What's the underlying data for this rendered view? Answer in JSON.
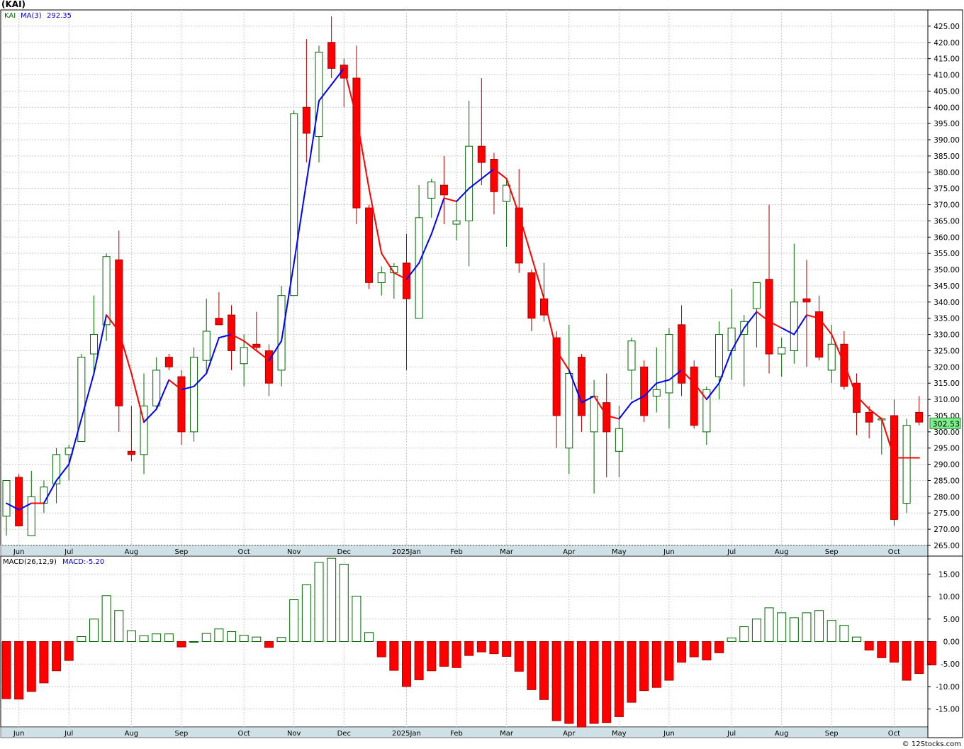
{
  "symbol_title": "(KAI)",
  "legend": {
    "ticker": "KAI",
    "ma_label": "MA(3)",
    "ma_value": "292.35",
    "macd_label": "MACD(26,12,9)",
    "macd_value_label": "MACD:-5.20"
  },
  "last_price_label": "302.53",
  "watermark": "© 12Stocks.com",
  "colors": {
    "up_candle": "#ffffff",
    "up_outline": "#006600",
    "down_candle": "#ff0000",
    "down_outline": "#aa0000",
    "wick": "#666666",
    "ma_up": "#0000ff",
    "ma_down": "#ff0000",
    "grid": "#c8c8c8",
    "axis_band": "#cfe0e6",
    "price_badge": "#7cf08a"
  },
  "chart_data": [
    {
      "type": "candlestick",
      "ylim": [
        265,
        430
      ],
      "yticks": [
        "265.00",
        "270.00",
        "275.00",
        "280.00",
        "285.00",
        "290.00",
        "295.00",
        "300.00",
        "305.00",
        "310.00",
        "315.00",
        "320.00",
        "325.00",
        "330.00",
        "335.00",
        "340.00",
        "345.00",
        "350.00",
        "355.00",
        "360.00",
        "365.00",
        "370.00",
        "375.00",
        "380.00",
        "385.00",
        "390.00",
        "395.00",
        "400.00",
        "405.00",
        "410.00",
        "415.00",
        "420.00",
        "425.00"
      ],
      "month_labels": [
        {
          "label": "Jun",
          "week": 1
        },
        {
          "label": "Jul",
          "week": 5
        },
        {
          "label": "Aug",
          "week": 10
        },
        {
          "label": "Sep",
          "week": 14
        },
        {
          "label": "Oct",
          "week": 19
        },
        {
          "label": "Nov",
          "week": 23
        },
        {
          "label": "Dec",
          "week": 27
        },
        {
          "label": "2025Jan",
          "week": 32
        },
        {
          "label": "Feb",
          "week": 36
        },
        {
          "label": "Mar",
          "week": 40
        },
        {
          "label": "Apr",
          "week": 45
        },
        {
          "label": "May",
          "week": 49
        },
        {
          "label": "Jun",
          "week": 53
        },
        {
          "label": "Jul",
          "week": 58
        },
        {
          "label": "Aug",
          "week": 62
        },
        {
          "label": "Sep",
          "week": 66
        },
        {
          "label": "Oct",
          "week": 71
        }
      ],
      "candles": [
        {
          "o": 274,
          "h": 285,
          "l": 268,
          "c": 285
        },
        {
          "o": 286,
          "h": 287,
          "l": 271,
          "c": 271
        },
        {
          "o": 268,
          "h": 288,
          "l": 268,
          "c": 280
        },
        {
          "o": 278,
          "h": 285,
          "l": 275,
          "c": 283
        },
        {
          "o": 284,
          "h": 295,
          "l": 278,
          "c": 293
        },
        {
          "o": 293,
          "h": 296,
          "l": 285,
          "c": 295
        },
        {
          "o": 297,
          "h": 324,
          "l": 297,
          "c": 323
        },
        {
          "o": 324,
          "h": 342,
          "l": 318,
          "c": 330
        },
        {
          "o": 333,
          "h": 355,
          "l": 328,
          "c": 354
        },
        {
          "o": 353,
          "h": 362,
          "l": 300,
          "c": 308
        },
        {
          "o": 294,
          "h": 308,
          "l": 291,
          "c": 293
        },
        {
          "o": 293,
          "h": 318,
          "l": 287,
          "c": 308
        },
        {
          "o": 308,
          "h": 323,
          "l": 307,
          "c": 319
        },
        {
          "o": 323,
          "h": 324,
          "l": 319,
          "c": 320
        },
        {
          "o": 317,
          "h": 319,
          "l": 296,
          "c": 300
        },
        {
          "o": 300,
          "h": 326,
          "l": 297,
          "c": 323
        },
        {
          "o": 322,
          "h": 341,
          "l": 318,
          "c": 331
        },
        {
          "o": 335,
          "h": 343,
          "l": 333,
          "c": 333
        },
        {
          "o": 336,
          "h": 339,
          "l": 319,
          "c": 325
        },
        {
          "o": 321,
          "h": 330,
          "l": 314,
          "c": 326
        },
        {
          "o": 327,
          "h": 337,
          "l": 325,
          "c": 326
        },
        {
          "o": 325,
          "h": 327,
          "l": 311,
          "c": 315
        },
        {
          "o": 319,
          "h": 345,
          "l": 314,
          "c": 342
        },
        {
          "o": 342,
          "h": 399,
          "l": 342,
          "c": 398
        },
        {
          "o": 400,
          "h": 421,
          "l": 383,
          "c": 392
        },
        {
          "o": 391,
          "h": 419,
          "l": 383,
          "c": 417
        },
        {
          "o": 420,
          "h": 428,
          "l": 409,
          "c": 412
        },
        {
          "o": 413,
          "h": 415,
          "l": 400,
          "c": 409
        },
        {
          "o": 409,
          "h": 419,
          "l": 364,
          "c": 369
        },
        {
          "o": 369,
          "h": 370,
          "l": 344,
          "c": 346
        },
        {
          "o": 346,
          "h": 351,
          "l": 342,
          "c": 349
        },
        {
          "o": 349,
          "h": 352,
          "l": 341,
          "c": 351
        },
        {
          "o": 352,
          "h": 361,
          "l": 319,
          "c": 341
        },
        {
          "o": 335,
          "h": 376,
          "l": 335,
          "c": 366
        },
        {
          "o": 372,
          "h": 378,
          "l": 366,
          "c": 377
        },
        {
          "o": 376,
          "h": 385,
          "l": 364,
          "c": 373
        },
        {
          "o": 364,
          "h": 371,
          "l": 359,
          "c": 365
        },
        {
          "o": 365,
          "h": 402,
          "l": 351,
          "c": 388
        },
        {
          "o": 388,
          "h": 409,
          "l": 376,
          "c": 383
        },
        {
          "o": 384,
          "h": 386,
          "l": 367,
          "c": 374
        },
        {
          "o": 371,
          "h": 378,
          "l": 357,
          "c": 376
        },
        {
          "o": 369,
          "h": 381,
          "l": 349,
          "c": 352
        },
        {
          "o": 349,
          "h": 350,
          "l": 331,
          "c": 335
        },
        {
          "o": 341,
          "h": 352,
          "l": 334,
          "c": 336
        },
        {
          "o": 329,
          "h": 331,
          "l": 295,
          "c": 305
        },
        {
          "o": 295,
          "h": 333,
          "l": 287,
          "c": 318
        },
        {
          "o": 323,
          "h": 324,
          "l": 300,
          "c": 305
        },
        {
          "o": 300,
          "h": 316,
          "l": 281,
          "c": 311
        },
        {
          "o": 309,
          "h": 318,
          "l": 286,
          "c": 300
        },
        {
          "o": 294,
          "h": 308,
          "l": 286,
          "c": 301
        },
        {
          "o": 319,
          "h": 329,
          "l": 310,
          "c": 328
        },
        {
          "o": 320,
          "h": 322,
          "l": 303,
          "c": 305
        },
        {
          "o": 311,
          "h": 326,
          "l": 306,
          "c": 313
        },
        {
          "o": 312,
          "h": 332,
          "l": 301,
          "c": 330
        },
        {
          "o": 333,
          "h": 339,
          "l": 311,
          "c": 315
        },
        {
          "o": 320,
          "h": 322,
          "l": 301,
          "c": 302
        },
        {
          "o": 300,
          "h": 314,
          "l": 296,
          "c": 313
        },
        {
          "o": 317,
          "h": 334,
          "l": 310,
          "c": 330
        },
        {
          "o": 325,
          "h": 344,
          "l": 316,
          "c": 332
        },
        {
          "o": 330,
          "h": 336,
          "l": 314,
          "c": 334
        },
        {
          "o": 338,
          "h": 346,
          "l": 326,
          "c": 346
        },
        {
          "o": 347,
          "h": 370,
          "l": 318,
          "c": 324
        },
        {
          "o": 324,
          "h": 329,
          "l": 317,
          "c": 326
        },
        {
          "o": 325,
          "h": 358,
          "l": 321,
          "c": 340
        },
        {
          "o": 341,
          "h": 353,
          "l": 320,
          "c": 340
        },
        {
          "o": 337,
          "h": 342,
          "l": 322,
          "c": 323
        },
        {
          "o": 319,
          "h": 333,
          "l": 315,
          "c": 327
        },
        {
          "o": 327,
          "h": 331,
          "l": 313,
          "c": 314
        },
        {
          "o": 315,
          "h": 318,
          "l": 299,
          "c": 306
        },
        {
          "o": 306,
          "h": 308,
          "l": 298,
          "c": 303
        },
        {
          "o": 304,
          "h": 304,
          "l": 293,
          "c": 304
        },
        {
          "o": 305,
          "h": 310,
          "l": 271,
          "c": 273
        },
        {
          "o": 278,
          "h": 304,
          "l": 275,
          "c": 302
        },
        {
          "o": 306,
          "h": 311,
          "l": 302,
          "c": 303
        }
      ],
      "ma": [
        {
          "v": 278,
          "dir": "down"
        },
        {
          "v": 276,
          "dir": "up"
        },
        {
          "v": 278,
          "dir": "up"
        },
        {
          "v": 278,
          "dir": "down"
        },
        {
          "v": 285,
          "dir": "up"
        },
        {
          "v": 290,
          "dir": "up"
        },
        {
          "v": 304,
          "dir": "up"
        },
        {
          "v": 318,
          "dir": "up"
        },
        {
          "v": 336,
          "dir": "up"
        },
        {
          "v": 331,
          "dir": "down"
        },
        {
          "v": 318,
          "dir": "down"
        },
        {
          "v": 303,
          "dir": "down"
        },
        {
          "v": 307,
          "dir": "up"
        },
        {
          "v": 316,
          "dir": "up"
        },
        {
          "v": 313,
          "dir": "down"
        },
        {
          "v": 314,
          "dir": "up"
        },
        {
          "v": 318,
          "dir": "up"
        },
        {
          "v": 329,
          "dir": "up"
        },
        {
          "v": 330,
          "dir": "up"
        },
        {
          "v": 328,
          "dir": "down"
        },
        {
          "v": 325,
          "dir": "down"
        },
        {
          "v": 322,
          "dir": "down"
        },
        {
          "v": 328,
          "dir": "up"
        },
        {
          "v": 352,
          "dir": "up"
        },
        {
          "v": 377,
          "dir": "up"
        },
        {
          "v": 402,
          "dir": "up"
        },
        {
          "v": 407,
          "dir": "up"
        },
        {
          "v": 412,
          "dir": "up"
        },
        {
          "v": 397,
          "dir": "down"
        },
        {
          "v": 375,
          "dir": "down"
        },
        {
          "v": 355,
          "dir": "down"
        },
        {
          "v": 349,
          "dir": "down"
        },
        {
          "v": 347,
          "dir": "down"
        },
        {
          "v": 352,
          "dir": "up"
        },
        {
          "v": 361,
          "dir": "up"
        },
        {
          "v": 372,
          "dir": "up"
        },
        {
          "v": 371,
          "dir": "down"
        },
        {
          "v": 375,
          "dir": "up"
        },
        {
          "v": 378,
          "dir": "up"
        },
        {
          "v": 381,
          "dir": "up"
        },
        {
          "v": 378,
          "dir": "down"
        },
        {
          "v": 367,
          "dir": "down"
        },
        {
          "v": 354,
          "dir": "down"
        },
        {
          "v": 341,
          "dir": "down"
        },
        {
          "v": 325,
          "dir": "down"
        },
        {
          "v": 319,
          "dir": "down"
        },
        {
          "v": 309,
          "dir": "up"
        },
        {
          "v": 311,
          "dir": "up"
        },
        {
          "v": 305,
          "dir": "down"
        },
        {
          "v": 304,
          "dir": "down"
        },
        {
          "v": 309,
          "dir": "up"
        },
        {
          "v": 311,
          "dir": "up"
        },
        {
          "v": 315,
          "dir": "up"
        },
        {
          "v": 316,
          "dir": "up"
        },
        {
          "v": 319,
          "dir": "up"
        },
        {
          "v": 315,
          "dir": "down"
        },
        {
          "v": 310,
          "dir": "down"
        },
        {
          "v": 315,
          "dir": "up"
        },
        {
          "v": 325,
          "dir": "up"
        },
        {
          "v": 332,
          "dir": "up"
        },
        {
          "v": 337,
          "dir": "up"
        },
        {
          "v": 334,
          "dir": "down"
        },
        {
          "v": 332,
          "dir": "down"
        },
        {
          "v": 330,
          "dir": "up"
        },
        {
          "v": 336,
          "dir": "up"
        },
        {
          "v": 335,
          "dir": "down"
        },
        {
          "v": 330,
          "dir": "down"
        },
        {
          "v": 321,
          "dir": "down"
        },
        {
          "v": 311,
          "dir": "down"
        },
        {
          "v": 307,
          "dir": "down"
        },
        {
          "v": 304,
          "dir": "down"
        },
        {
          "v": 292,
          "dir": "down"
        },
        {
          "v": 292,
          "dir": "down"
        },
        {
          "v": 292,
          "dir": "down"
        }
      ]
    },
    {
      "type": "bar",
      "name": "MACD(26,12,9)",
      "ylim": [
        -19,
        19
      ],
      "yticks": [
        "15.00",
        "10.00",
        "5.00",
        "0.00",
        "-5.00",
        "-10.00",
        "-15.00"
      ],
      "ytick_values": [
        15,
        10,
        5,
        0,
        -5,
        -10,
        -15
      ],
      "values": [
        -12.7,
        -12.8,
        -11.1,
        -9.2,
        -6.5,
        -4.2,
        1.1,
        5.0,
        10.2,
        6.9,
        2.4,
        1.3,
        1.7,
        1.7,
        -1.2,
        0,
        1.8,
        2.8,
        2.2,
        1.4,
        1.0,
        -1.3,
        0.9,
        9.3,
        12.6,
        17.6,
        18.5,
        17.2,
        10.1,
        2.0,
        -3.4,
        -6.4,
        -10.0,
        -8.5,
        -6.5,
        -5.5,
        -5.8,
        -3.1,
        -2.3,
        -2.7,
        -3.3,
        -6.6,
        -10.7,
        -12.9,
        -17.6,
        -18.2,
        -19.0,
        -18.2,
        -18.0,
        -16.7,
        -13.5,
        -10.9,
        -10.2,
        -8.6,
        -4.6,
        -3.4,
        -4.1,
        -2.5,
        0.8,
        3.3,
        5.0,
        7.5,
        6.4,
        5.3,
        6.4,
        6.9,
        4.7,
        3.6,
        1.0,
        -1.9,
        -3.6,
        -4.6,
        -8.6,
        -7.1,
        -5.2
      ]
    }
  ]
}
